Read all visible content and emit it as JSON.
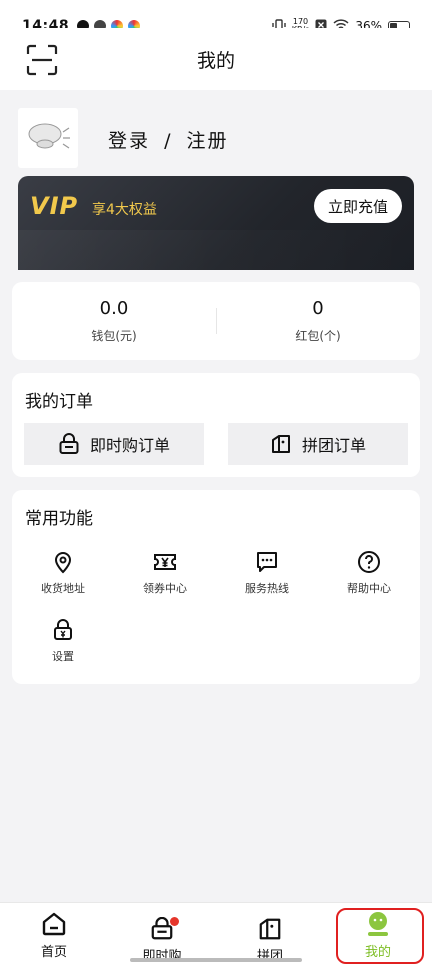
{
  "status_bar": {
    "time": "14:48",
    "net_speed_top": "170",
    "net_speed_bottom": "KB/s",
    "battery": "36%"
  },
  "header": {
    "title": "我的"
  },
  "profile": {
    "login": "登录",
    "separator": "/",
    "register": "注册"
  },
  "vip": {
    "logo": "VIP",
    "subtitle": "享4大权益",
    "recharge": "立即充值",
    "accent": "#f2c94c"
  },
  "wallet": {
    "balance_value": "0.0",
    "balance_label": "钱包(元)",
    "redpacket_value": "0",
    "redpacket_label": "红包(个)"
  },
  "orders": {
    "title": "我的订单",
    "instant": "即时购订单",
    "group": "拼团订单"
  },
  "functions": {
    "title": "常用功能",
    "items": [
      {
        "label": "收货地址",
        "icon": "location-pin-icon"
      },
      {
        "label": "领券中心",
        "icon": "coupon-icon"
      },
      {
        "label": "服务热线",
        "icon": "chat-icon"
      },
      {
        "label": "帮助中心",
        "icon": "help-icon"
      },
      {
        "label": "设置",
        "icon": "lock-settings-icon"
      }
    ]
  },
  "tabbar": {
    "items": [
      {
        "label": "首页"
      },
      {
        "label": "即时购"
      },
      {
        "label": "拼团"
      },
      {
        "label": "我的"
      }
    ],
    "active_color": "#7dbe25"
  }
}
